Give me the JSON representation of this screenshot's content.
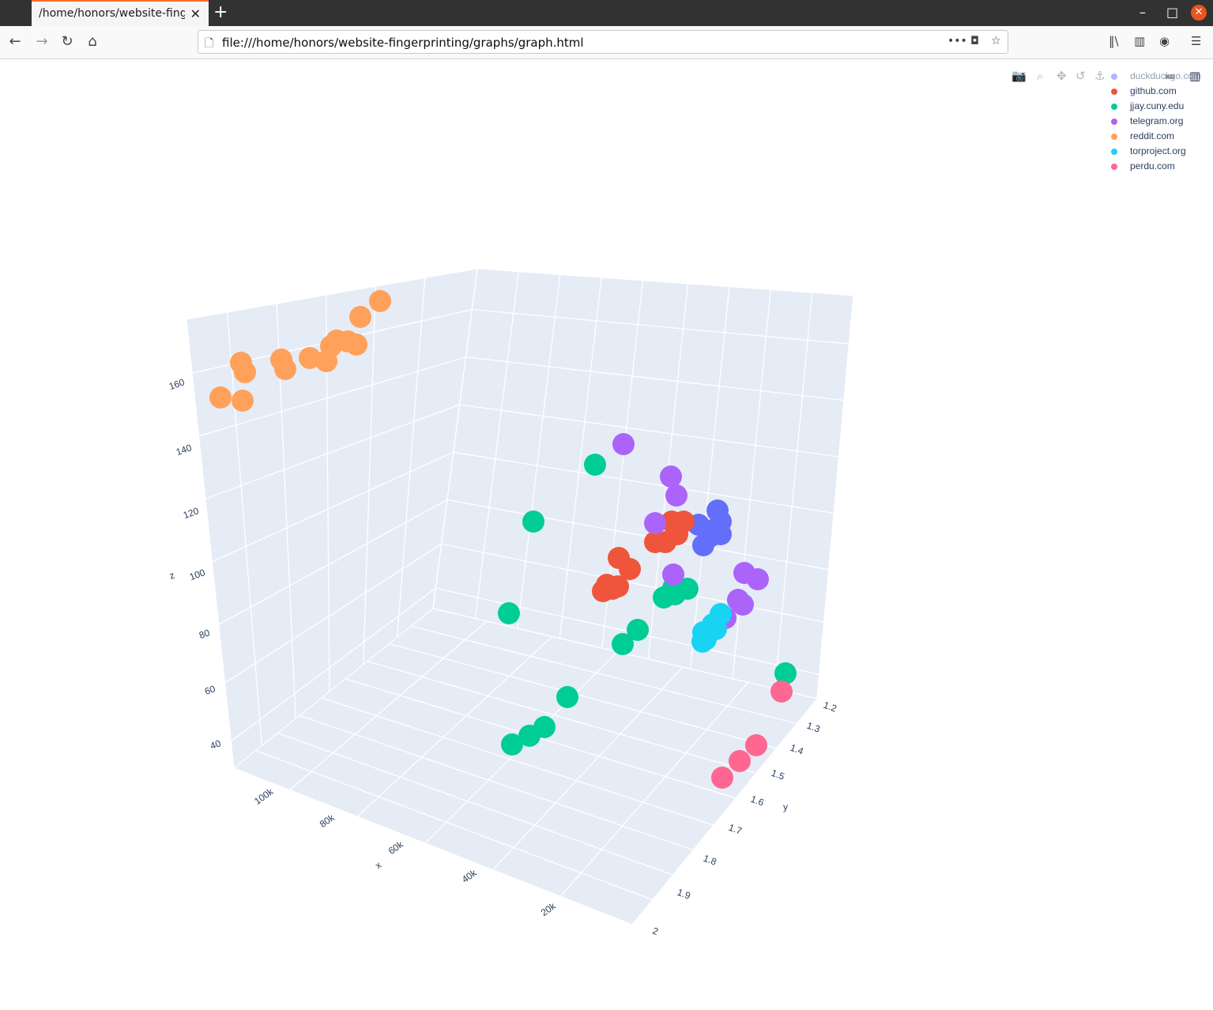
{
  "browser": {
    "tab_title": "/home/honors/website-fingerprinting/graphs/graph.html",
    "new_tab": "+",
    "url": "file:///home/honors/website-fingerprinting/graphs/graph.html",
    "page_actions": "•••"
  },
  "chart_data": {
    "type": "scatter3d",
    "axes": {
      "x": {
        "label": "x",
        "ticks": [
          "20k",
          "40k",
          "60k",
          "80k",
          "100k"
        ]
      },
      "y": {
        "label": "y",
        "ticks": [
          "1.2",
          "1.3",
          "1.4",
          "1.5",
          "1.6",
          "1.7",
          "1.8",
          "1.9",
          "2"
        ]
      },
      "z": {
        "label": "z",
        "ticks": [
          "40",
          "60",
          "80",
          "100",
          "120",
          "140",
          "160"
        ]
      }
    },
    "legend_position": "top-right",
    "series": [
      {
        "name": "duckduckgo.com",
        "color": "#636efa"
      },
      {
        "name": "github.com",
        "color": "#ef553b"
      },
      {
        "name": "jjay.cuny.edu",
        "color": "#00cc96"
      },
      {
        "name": "telegram.org",
        "color": "#ab63fa"
      },
      {
        "name": "reddit.com",
        "color": "#ffa15a"
      },
      {
        "name": "torproject.org",
        "color": "#19d3f3"
      },
      {
        "name": "perdu.com",
        "color": "#ff6692"
      }
    ]
  }
}
